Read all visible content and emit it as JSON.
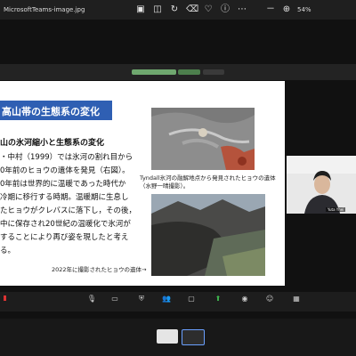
{
  "viewer": {
    "title": "MicrosoftTeams-image.jpg",
    "zoom": "54%"
  },
  "slide": {
    "title": "高山帯の生態系の変化",
    "subtitle": "山の氷河縮小と生態系の変化",
    "paragraph_lines": [
      "・中村（1999）では氷河の割れ目から",
      "0年前のヒョウの遺体を発見（右図）。",
      "0年前は世界的に温暖であった時代か",
      "冷期に移行する時期。温暖期に生息し",
      "たヒョウがクレバスに落下し，その後，",
      "中に保存され20世紀の温暖化で氷河が",
      "することにより再び姿を現したと考え",
      "る。"
    ],
    "photo_caption_line1": "Tyndall氷河の融解地点から発見されたヒョウの遺体",
    "photo_caption_line2": "（水野一晴撮影）。",
    "bottom_caption": "2022年に撮影されたヒョウの遺体→"
  },
  "participant": {
    "name": "Yuta Yhei"
  },
  "toolbar_icons": [
    "save-icon",
    "layers-icon",
    "rotate-icon",
    "trash-icon",
    "heart-icon",
    "info-icon",
    "more-icon",
    "zoom-out-icon",
    "zoom-in-icon"
  ],
  "colors": {
    "accent": "#2f5fb3",
    "background": "#1c1c1c"
  }
}
